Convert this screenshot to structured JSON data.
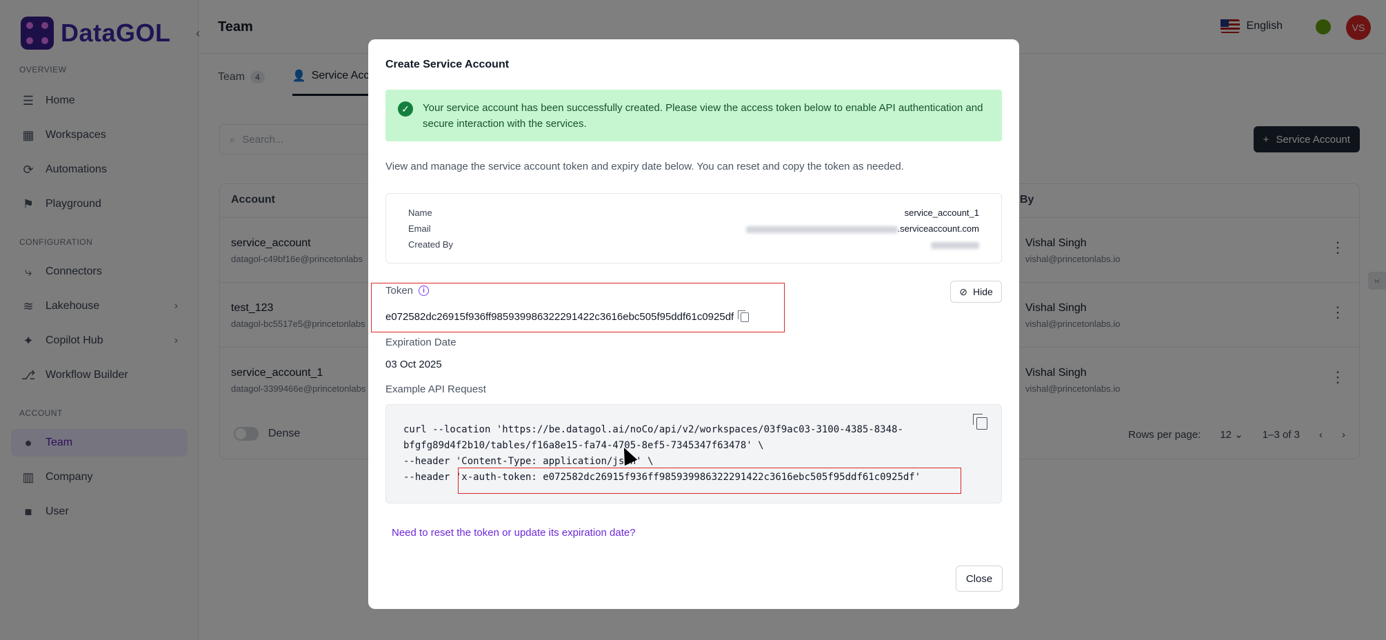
{
  "app": {
    "logo_text": "DataGOL",
    "page_title": "Team",
    "language": "English",
    "avatar_initials": "VS",
    "sidebar": {
      "overview_label": "OVERVIEW",
      "configuration_label": "CONFIGURATION",
      "account_label": "ACCOUNT",
      "items": [
        {
          "label": "Home",
          "icon": "home-icon"
        },
        {
          "label": "Workspaces",
          "icon": "workspaces-icon"
        },
        {
          "label": "Automations",
          "icon": "automations-icon"
        },
        {
          "label": "Playground",
          "icon": "playground-icon"
        },
        {
          "label": "Connectors",
          "icon": "connectors-icon"
        },
        {
          "label": "Lakehouse",
          "icon": "lakehouse-icon"
        },
        {
          "label": "Copilot Hub",
          "icon": "copilot-icon"
        },
        {
          "label": "Workflow Builder",
          "icon": "workflow-icon"
        },
        {
          "label": "Team",
          "icon": "team-icon"
        },
        {
          "label": "Company",
          "icon": "company-icon"
        },
        {
          "label": "User",
          "icon": "user-icon"
        }
      ]
    },
    "tabs": [
      {
        "label": "Team",
        "count": "4"
      },
      {
        "label": "Service Acc"
      }
    ],
    "search_placeholder": "Search...",
    "add_button": "Service Account",
    "table": {
      "col_account": "Account",
      "col_by": "By",
      "rows": [
        {
          "name": "service_account",
          "email": "datagol-c49bf16e@princetonlabs",
          "by": "Vishal Singh",
          "by_email": "vishal@princetonlabs.io"
        },
        {
          "name": "test_123",
          "email": "datagol-bc5517e5@princetonlabs",
          "by": "Vishal Singh",
          "by_email": "vishal@princetonlabs.io"
        },
        {
          "name": "service_account_1",
          "email": "datagol-3399466e@princetonlabs",
          "by": "Vishal Singh",
          "by_email": "vishal@princetonlabs.io"
        }
      ],
      "dense_label": "Dense",
      "rows_per_page_label": "Rows per page:",
      "rows_per_page": "12",
      "range": "1–3 of 3"
    }
  },
  "modal": {
    "title": "Create Service Account",
    "success_message": "Your service account has been successfully created. Please view the access token below to enable API authentication and secure interaction with the services.",
    "intro": "View and manage the service account token and expiry date below. You can reset and copy the token as needed.",
    "info": {
      "name_label": "Name",
      "name_value": "service_account_1",
      "email_label": "Email",
      "email_value_suffix": ".serviceaccount.com",
      "created_by_label": "Created By"
    },
    "token_label": "Token",
    "token_value": "e072582dc26915f936ff985939986322291422c3616ebc505f95ddf61c0925df",
    "hide_label": "Hide",
    "expiration_label": "Expiration Date",
    "expiration_value": "03 Oct 2025",
    "api_label": "Example API Request",
    "code": {
      "line1": "curl --location 'https://be.datagol.ai/noCo/api/v2/workspaces/03f9ac03-3100-4385-8348-",
      "line2": "bfgfg89d4f2b10/tables/f16a8e15-fa74-4705-8ef5-7345347f63478' \\",
      "line3": "--header 'Content-Type: application/json' \\",
      "line4_prefix": "--header ",
      "line4_token": "'x-auth-token: e072582dc26915f936ff985939986322291422c3616ebc505f95ddf61c0925df'"
    },
    "reset_link": "Need to reset the token or update its expiration date?",
    "close_label": "Close"
  }
}
